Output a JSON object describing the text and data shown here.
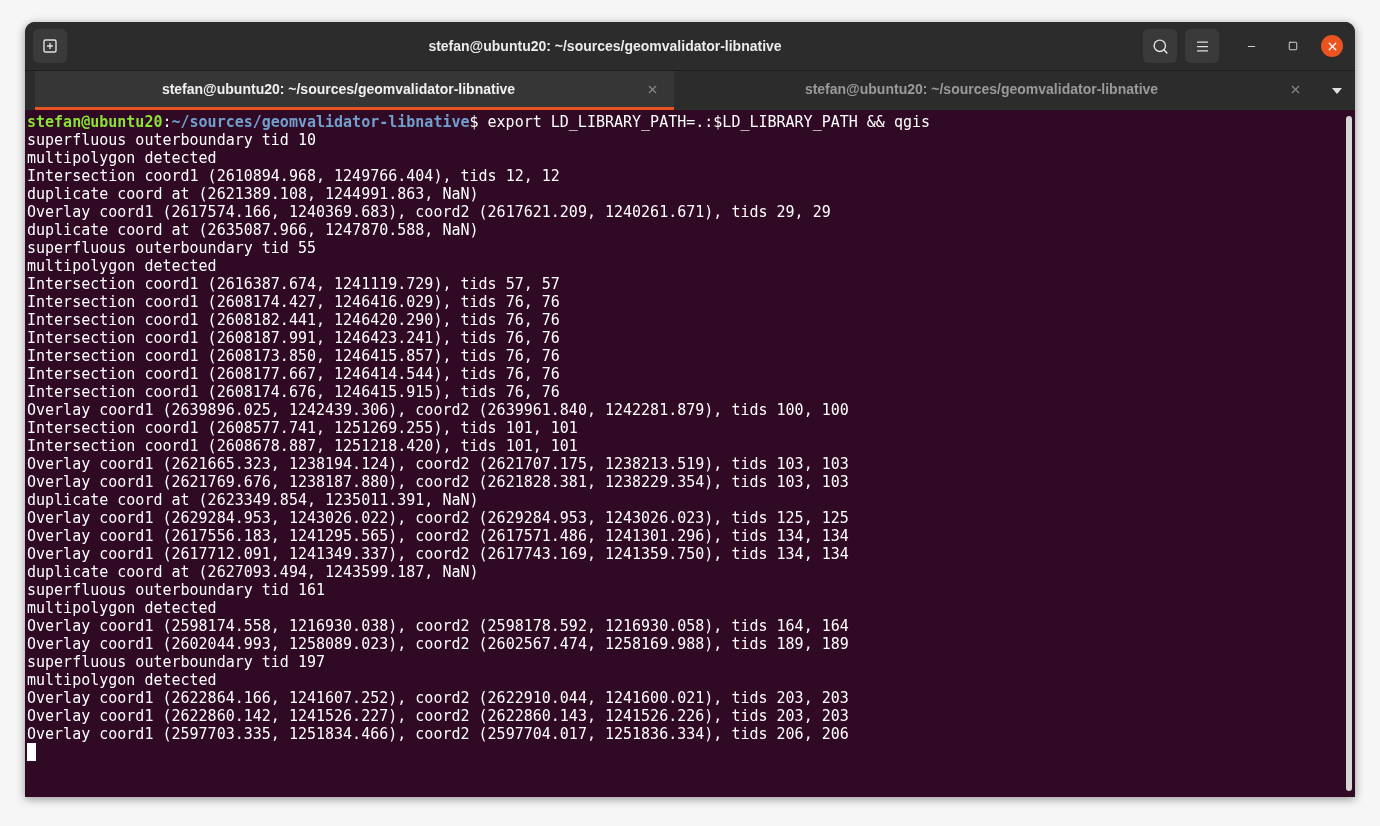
{
  "window": {
    "title": "stefan@ubuntu20: ~/sources/geomvalidator-libnative"
  },
  "tabs": [
    {
      "label": "stefan@ubuntu20: ~/sources/geomvalidator-libnative",
      "selected": true
    },
    {
      "label": "stefan@ubuntu20: ~/sources/geomvalidator-libnative",
      "selected": false
    }
  ],
  "prompt": {
    "user_host": "stefan@ubuntu20",
    "separator": ":",
    "path": "~/sources/geomvalidator-libnative",
    "symbol": "$",
    "command": "export LD_LIBRARY_PATH=.:$LD_LIBRARY_PATH && qgis"
  },
  "output": [
    "superfluous outerboundary tid 10",
    "multipolygon detected",
    "Intersection coord1 (2610894.968, 1249766.404), tids 12, 12",
    "duplicate coord at (2621389.108, 1244991.863, NaN)",
    "Overlay coord1 (2617574.166, 1240369.683), coord2 (2617621.209, 1240261.671), tids 29, 29",
    "duplicate coord at (2635087.966, 1247870.588, NaN)",
    "superfluous outerboundary tid 55",
    "multipolygon detected",
    "Intersection coord1 (2616387.674, 1241119.729), tids 57, 57",
    "Intersection coord1 (2608174.427, 1246416.029), tids 76, 76",
    "Intersection coord1 (2608182.441, 1246420.290), tids 76, 76",
    "Intersection coord1 (2608187.991, 1246423.241), tids 76, 76",
    "Intersection coord1 (2608173.850, 1246415.857), tids 76, 76",
    "Intersection coord1 (2608177.667, 1246414.544), tids 76, 76",
    "Intersection coord1 (2608174.676, 1246415.915), tids 76, 76",
    "Overlay coord1 (2639896.025, 1242439.306), coord2 (2639961.840, 1242281.879), tids 100, 100",
    "Intersection coord1 (2608577.741, 1251269.255), tids 101, 101",
    "Intersection coord1 (2608678.887, 1251218.420), tids 101, 101",
    "Overlay coord1 (2621665.323, 1238194.124), coord2 (2621707.175, 1238213.519), tids 103, 103",
    "Overlay coord1 (2621769.676, 1238187.880), coord2 (2621828.381, 1238229.354), tids 103, 103",
    "duplicate coord at (2623349.854, 1235011.391, NaN)",
    "Overlay coord1 (2629284.953, 1243026.022), coord2 (2629284.953, 1243026.023), tids 125, 125",
    "Overlay coord1 (2617556.183, 1241295.565), coord2 (2617571.486, 1241301.296), tids 134, 134",
    "Overlay coord1 (2617712.091, 1241349.337), coord2 (2617743.169, 1241359.750), tids 134, 134",
    "duplicate coord at (2627093.494, 1243599.187, NaN)",
    "superfluous outerboundary tid 161",
    "multipolygon detected",
    "Overlay coord1 (2598174.558, 1216930.038), coord2 (2598178.592, 1216930.058), tids 164, 164",
    "Overlay coord1 (2602044.993, 1258089.023), coord2 (2602567.474, 1258169.988), tids 189, 189",
    "superfluous outerboundary tid 197",
    "multipolygon detected",
    "Overlay coord1 (2622864.166, 1241607.252), coord2 (2622910.044, 1241600.021), tids 203, 203",
    "Overlay coord1 (2622860.142, 1241526.227), coord2 (2622860.143, 1241526.226), tids 203, 203",
    "Overlay coord1 (2597703.335, 1251834.466), coord2 (2597704.017, 1251836.334), tids 206, 206"
  ],
  "cursor_visible": true
}
